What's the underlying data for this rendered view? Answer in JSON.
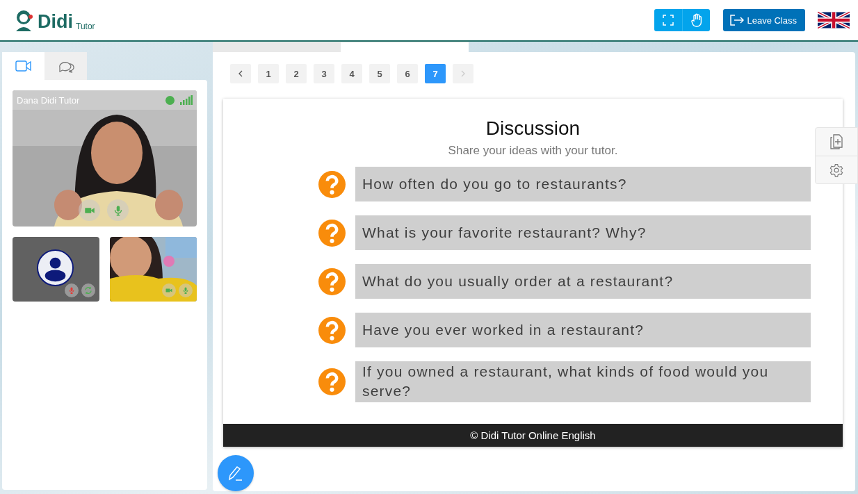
{
  "header": {
    "logo_main": "Didi",
    "logo_sub": "Tutor",
    "leave_button": "Leave Class"
  },
  "side_tabs": [
    {
      "kind": "video",
      "selected": true
    },
    {
      "kind": "chat",
      "selected": false
    }
  ],
  "main_feed": {
    "name": "Dana Didi Tutor",
    "camera_on": true,
    "mic_on": true
  },
  "thumb_feeds": [
    {
      "kind": "avatar",
      "mic_on": false
    },
    {
      "kind": "video",
      "mic_on": true
    }
  ],
  "pagination": {
    "prev_disabled": false,
    "next_disabled": true,
    "pages": [
      {
        "label": "1",
        "selected": false
      },
      {
        "label": "2",
        "selected": false
      },
      {
        "label": "3",
        "selected": false
      },
      {
        "label": "4",
        "selected": false
      },
      {
        "label": "5",
        "selected": false
      },
      {
        "label": "6",
        "selected": false
      },
      {
        "label": "7",
        "selected": true
      }
    ]
  },
  "slide": {
    "title": "Discussion",
    "subtitle": "Share your ideas with your tutor.",
    "questions": [
      "How often do you go to restaurants?",
      "What is your favorite restaurant? Why?",
      "What do you usually order at a restaurant?",
      "Have you ever worked in a restaurant?",
      "If you owned a restaurant, what kinds of food would you serve?"
    ],
    "footer": "© Didi Tutor Online English"
  }
}
